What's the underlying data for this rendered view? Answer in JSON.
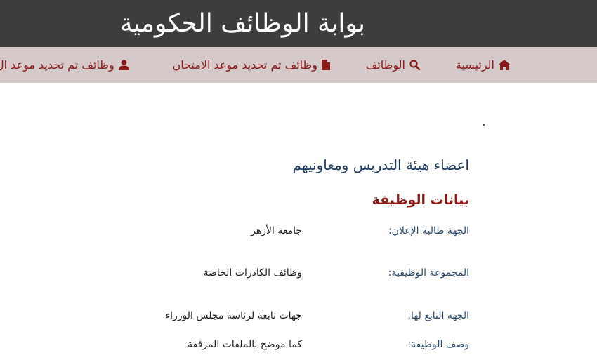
{
  "header": {
    "title": "بوابة الوظائف الحكومية"
  },
  "nav": {
    "items": [
      {
        "label": "الرئيسية",
        "icon": "home-icon"
      },
      {
        "label": "الوظائف",
        "icon": "search-icon"
      },
      {
        "label": "وظائف تم تحديد موعد الامتحان",
        "icon": "file-icon"
      },
      {
        "label": "وظائف تم تحديد موعد ال",
        "icon": "user-icon"
      }
    ]
  },
  "job": {
    "title": "اعضاء هيئة التدريس ومعاونيهم",
    "section_title": "بيانات الوظيفة",
    "fields": [
      {
        "label": "الجهة طالبة الإعلان:",
        "value": "جامعة الأزهر"
      },
      {
        "label": "المجموعة الوظيفية:",
        "value": "وظائف الكادرات الخاصة"
      },
      {
        "label": "الجهه التابع لها:",
        "value": "جهات تابعة لرئاسة مجلس الوزراء"
      },
      {
        "label": "وصف الوظيفة:",
        "value": "كما موضح بالملفات المرفقة"
      }
    ]
  },
  "colors": {
    "header_bg": "#3d3d3d",
    "nav_bg": "#d5c9c9",
    "accent": "#8b1a1a",
    "label": "#2c4a6b"
  }
}
